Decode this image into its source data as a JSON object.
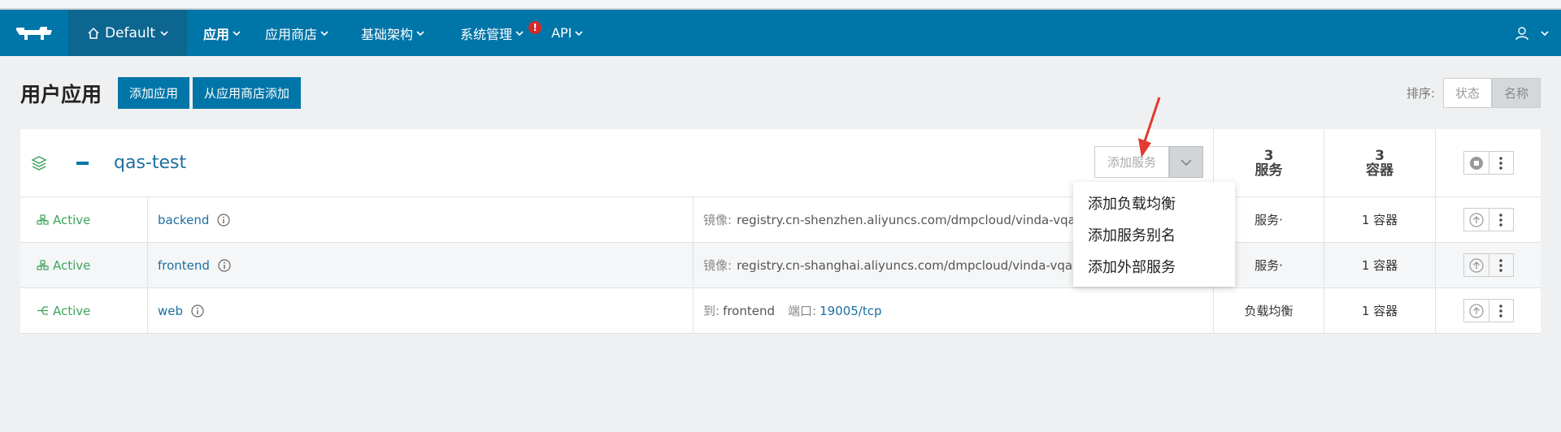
{
  "nav": {
    "environment": "Default",
    "items": [
      {
        "label": "应用",
        "active": true
      },
      {
        "label": "应用商店",
        "active": false
      },
      {
        "label": "基础架构",
        "active": false
      },
      {
        "label": "系统管理",
        "active": false,
        "alert": "!"
      },
      {
        "label": "API",
        "active": false
      }
    ]
  },
  "header": {
    "title": "用户应用",
    "add_app": "添加应用",
    "add_from_catalog": "从应用商店添加",
    "sort_label": "排序:",
    "sort_state": "状态",
    "sort_name": "名称"
  },
  "stack": {
    "name": "qas-test",
    "add_service": "添加服务",
    "services_count": "3",
    "services_label": "服务",
    "containers_count": "3",
    "containers_label": "容器"
  },
  "services": [
    {
      "state": "Active",
      "name": "backend",
      "image_label": "镜像:",
      "image": "registry.cn-shenzhen.aliyuncs.com/dmpcloud/vinda-vqas-b",
      "type": "服务·",
      "containers": "1 容器"
    },
    {
      "state": "Active",
      "name": "frontend",
      "image_label": "镜像:",
      "image": "registry.cn-shanghai.aliyuncs.com/dmpcloud/vinda-vqas-fr",
      "type": "服务·",
      "containers": "1 容器"
    },
    {
      "state": "Active",
      "name": "web",
      "to_label": "到:",
      "to": "frontend",
      "port_label": "端口:",
      "port": "19005/tcp",
      "type": "负载均衡",
      "containers": "1 容器"
    }
  ],
  "dropdown": [
    "添加负载均衡",
    "添加服务别名",
    "添加外部服务"
  ],
  "colors": {
    "brand": "#0075a8",
    "active": "#3ea55d",
    "link": "#1d6fa0"
  }
}
